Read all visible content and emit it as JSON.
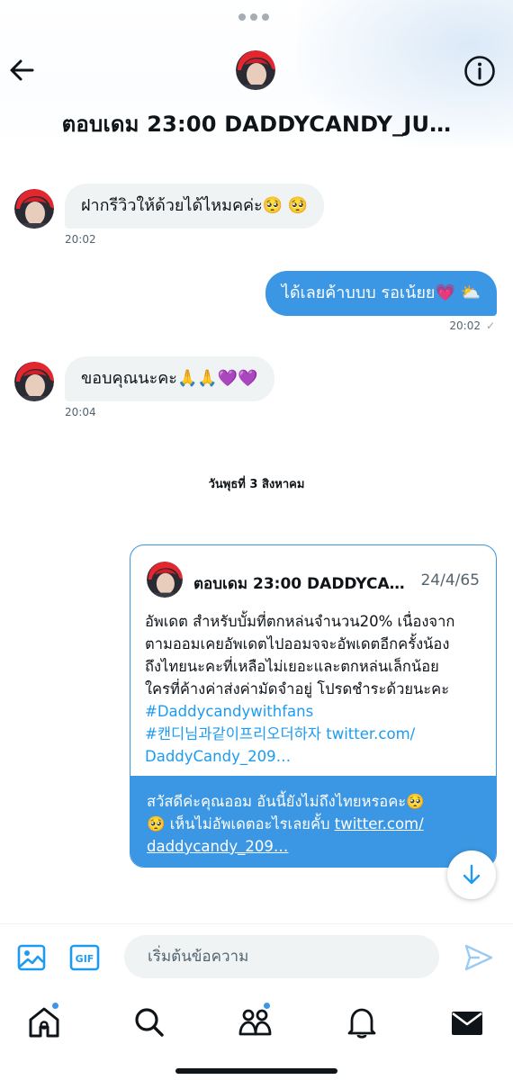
{
  "header": {
    "title": "ตอบเดม 23:00 DADDYCANDY_JU…"
  },
  "messages": [
    {
      "direction": "in",
      "text": "ฝากรีวิวให้ด้วยได้ไหมคค่ะ🥺 🥺",
      "time": "20:02"
    },
    {
      "direction": "out",
      "text": "ได้เลยค้าบบบ รอเน้ยย💗 ⛅",
      "time": "20:02",
      "status": "✓"
    },
    {
      "direction": "in",
      "text": "ขอบคุณนะคะ🙏🙏💜💜",
      "time": "20:04"
    }
  ],
  "date_separator": "วันพุธที่ 3 สิงหาคม",
  "card": {
    "author": "ตอบเดม 23:00 DADDYCA…",
    "date": "24/4/65",
    "lines": [
      "อัพเดต สำหรับบั้มที่ตกหล่นจำนวน20% เนื่องจาก",
      "ตามออมเคยอัพเดตไปออมจจะอัพเดตอีกครั้งน้อง",
      "ถึงไทยนะคะที่เหลือไม่เยอะและตกหล่นเล็กน้อย",
      "ใครที่ค้างค่าส่งค่ามัดจำอยู่ โปรดชำระด้วยนะคะ"
    ],
    "hashtag1": "#Daddycandywithfans",
    "hashtag2": "#캔디님과같이프리오더하자",
    "link1": " twitter.com/",
    "link2": "DaddyCandy_209…",
    "reply_line1": "สวัสดีค่ะคุณออม อันนี้ยังไม่ถึงไทยหรอคะ🥺",
    "reply_line2_text": "🥺 เห็นไม่อัพเดตอะไรเลยคั้บ ",
    "reply_line2_link": "twitter.com/",
    "reply_line3_link": "daddycandy_209…"
  },
  "composer": {
    "placeholder": "เริ่มต้นข้อความ"
  },
  "icons": {
    "back": "arrow-left-icon",
    "info": "info-icon",
    "media": "image-icon",
    "gif": "gif-icon",
    "send": "send-icon",
    "scroll": "arrow-down-icon",
    "tabs": [
      "home-icon",
      "search-icon",
      "communities-icon",
      "bell-icon",
      "mail-icon"
    ]
  },
  "colors": {
    "accent": "#1d9bf0",
    "bubble_out": "#3b97e3",
    "bubble_in": "#eff3f4"
  }
}
